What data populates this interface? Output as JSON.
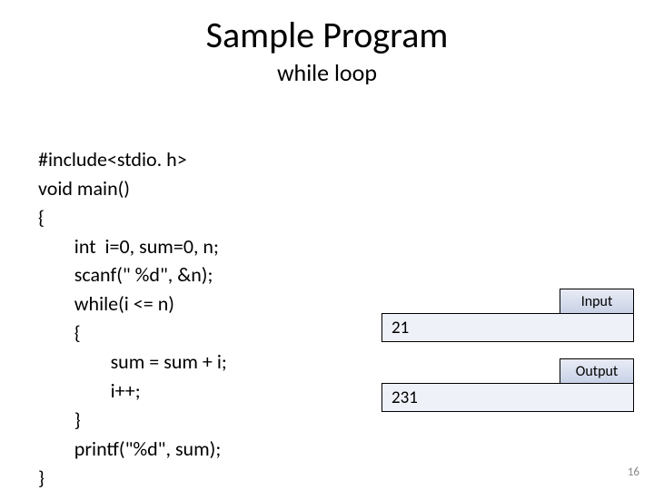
{
  "title": "Sample Program",
  "subtitle": "while loop",
  "code": {
    "l1": "#include<stdio. h>",
    "l2": "void main()",
    "l3": "{",
    "l4": "        int  i=0, sum=0, n;",
    "l5": "        scanf(\" %d\", &n);",
    "l6": "        while(i <= n)",
    "l7": "        {",
    "l8": "                sum = sum + i;",
    "l9": "                i++;",
    "l10": "        }",
    "l11": "        printf(\"%d\", sum);",
    "l12": "}"
  },
  "io": {
    "input_label": "Input",
    "input_value": "21",
    "output_label": "Output",
    "output_value": "231"
  },
  "page_number": "16"
}
